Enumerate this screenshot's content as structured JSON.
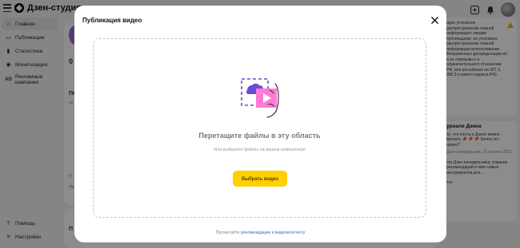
{
  "app": {
    "brand": "Дзен-студия",
    "sidebar": [
      {
        "label": "Главное",
        "icon": "home-icon"
      },
      {
        "label": "Публикации",
        "icon": "publications-icon"
      },
      {
        "label": "Статистика",
        "icon": "stats-icon"
      },
      {
        "label": "Монетизация",
        "icon": "money-icon"
      },
      {
        "label": "Рекламные кампании",
        "icon": "ads-icon"
      }
    ],
    "sidebar_bottom": [
      {
        "label": "Помощь",
        "icon": "help-icon"
      },
      {
        "label": "Настройки",
        "icon": "settings-icon"
      }
    ],
    "background_snippets": {
      "zero": "0",
      "po": "По",
      "za": "за",
      "n": "Н",
      "po_link": "По",
      "p": "П"
    },
    "right_notice": {
      "text": "идео уголовное распространение ложной информации» вашим публикациям: ли уголовное распространение ложной информации использовании Вооруженных дискредитацию их и за «призывы к р ограничительного отношении РФ, или российских ии 207.3, 280.3 и кового кодекса РФ)."
    },
    "right_journal": {
      "title": "урнале Дзена",
      "text": "те, что посты в Дзене можно крепить 📌 📌 📌 Зачем это нужно?",
      "meta": "Дзен-понедельник, 10 апреля 2022",
      "text2": "оги Дзен-понедельника: рование рекомендаций и еких новых инструментов для...",
      "link": "тся"
    }
  },
  "modal": {
    "title": "Публикация видео",
    "drop_title": "Перетащите файлы в эту область",
    "drop_subtitle": "Или выберите файлы на вашем компьютере",
    "button_label": "Выбрать видео",
    "footer_prefix": "Прочитайте ",
    "footer_link": "рекомендации к видеоконтенту"
  },
  "colors": {
    "accent": "#ffd000",
    "link": "#2b6ed6",
    "illus_purple": "#6a4bd6",
    "illus_pink": "#ff7bd5"
  }
}
